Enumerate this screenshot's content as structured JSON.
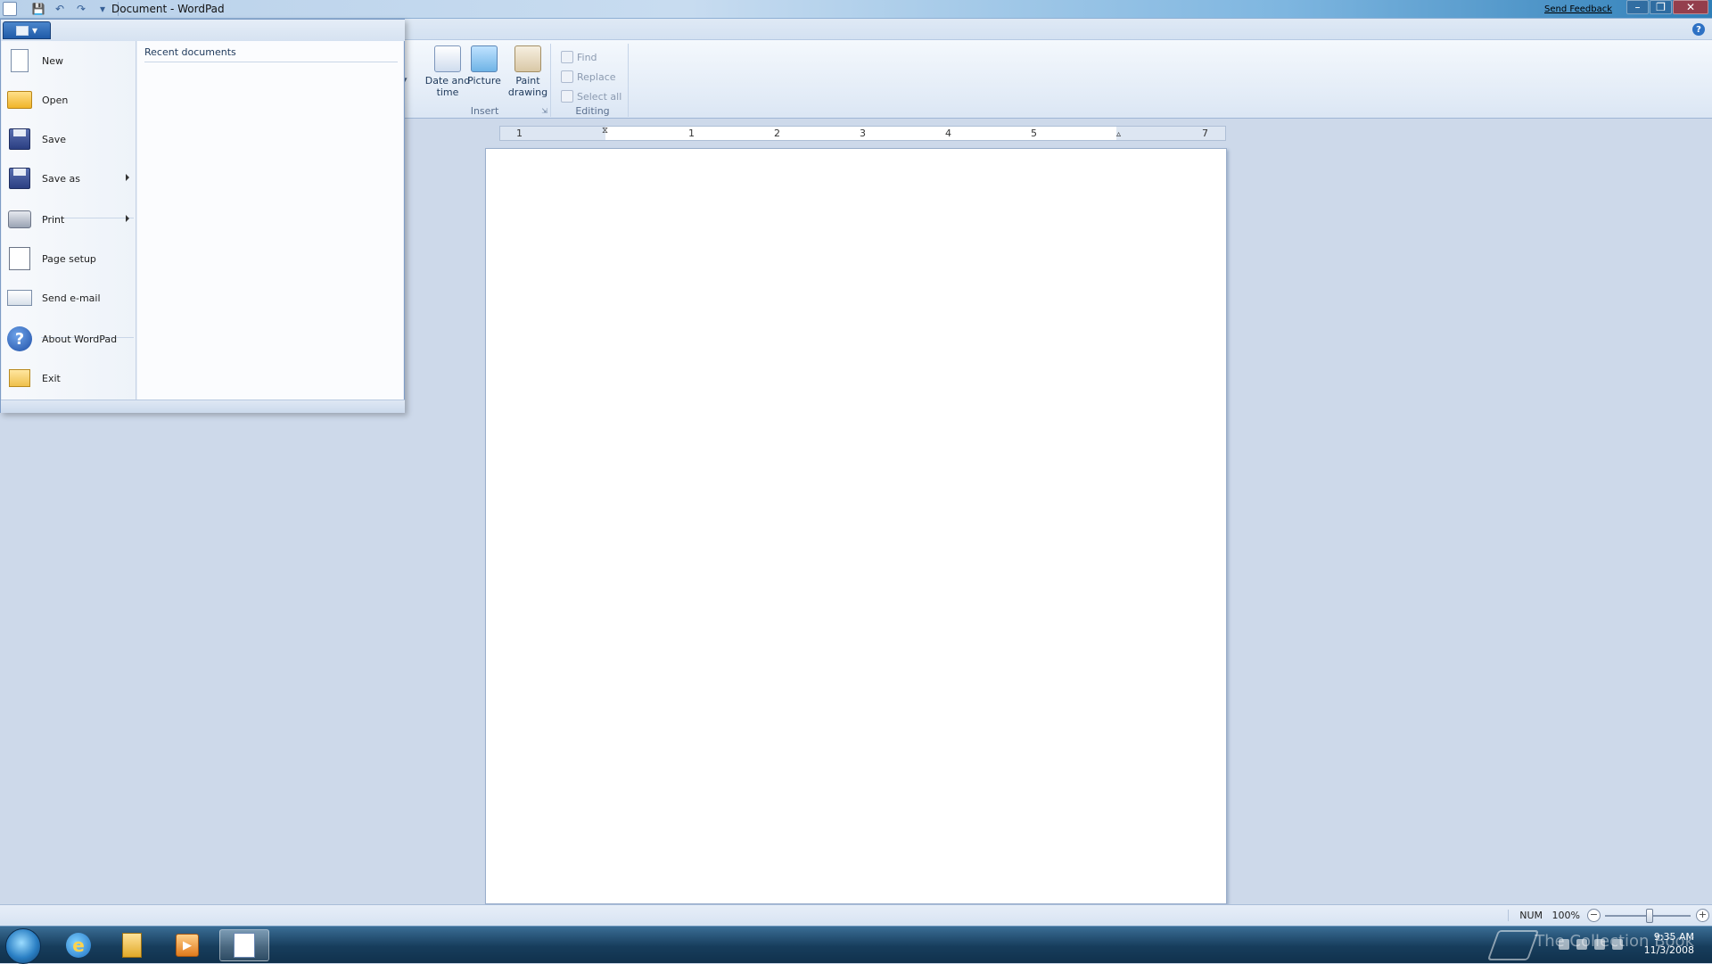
{
  "window": {
    "title": "Document - WordPad",
    "send_feedback": "Send Feedback",
    "minimize": "–",
    "restore": "❐",
    "close": "✕"
  },
  "qat": {
    "save_icon": "💾",
    "undo_icon": "↶",
    "redo_icon": "↷",
    "customize_icon": "▾"
  },
  "ribbon": {
    "insert": {
      "label": "Insert",
      "date_time": "Date and time",
      "picture": "Picture",
      "paint_drawing": "Paint drawing"
    },
    "editing": {
      "label": "Editing",
      "find": "Find",
      "replace": "Replace",
      "select_all": "Select all"
    },
    "help": "?"
  },
  "ruler": {
    "labels": [
      "1",
      "1",
      "2",
      "3",
      "4",
      "5",
      "7"
    ]
  },
  "app_menu": {
    "recent_header": "Recent documents",
    "items": [
      {
        "label": "New"
      },
      {
        "label": "Open"
      },
      {
        "label": "Save"
      },
      {
        "label": "Save as"
      },
      {
        "label": "Print"
      },
      {
        "label": "Page setup"
      },
      {
        "label": "Send e-mail"
      },
      {
        "label": "About WordPad"
      },
      {
        "label": "Exit"
      }
    ],
    "about_glyph": "?"
  },
  "statusbar": {
    "num": "NUM",
    "zoom": "100%",
    "zoom_out": "−",
    "zoom_in": "+",
    "zoom_level": 100
  },
  "taskbar": {
    "time": "9:35 AM",
    "date": "11/3/2008",
    "watermark": "The Collection Book",
    "ie_glyph": "e",
    "media_glyph": "▶"
  }
}
